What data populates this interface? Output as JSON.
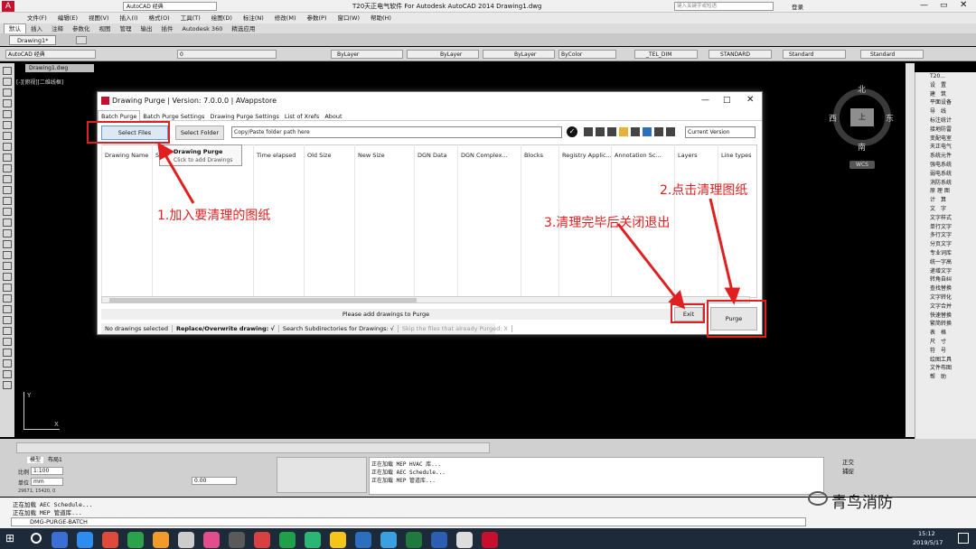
{
  "titlebar": {
    "title": "T20天正电气软件 For Autodesk AutoCAD 2014    Drawing1.dwg",
    "workspace": "AutoCAD 经典",
    "search_placeholder": "键入关键字或短语",
    "login": "登录"
  },
  "menus": [
    "文件(F)",
    "编辑(E)",
    "视图(V)",
    "插入(I)",
    "格式(O)",
    "工具(T)",
    "绘图(D)",
    "标注(N)",
    "修改(M)",
    "参数(P)",
    "窗口(W)",
    "帮助(H)"
  ],
  "ribbon_tabs": [
    "默认",
    "插入",
    "注释",
    "参数化",
    "视图",
    "管理",
    "输出",
    "插件",
    "Autodesk 360",
    "精选应用"
  ],
  "doc_tab": "Drawing1*",
  "props": {
    "workspace": "AutoCAD 经典",
    "layer": "0",
    "color": "ByLayer",
    "linetype": "ByLayer",
    "lineweight": "ByLayer",
    "plotstyle": "ByColor",
    "dimstyle": "_TEL_DIM",
    "textstyle": "STANDARD",
    "tablestyle": "Standard",
    "mlstyle": "Standard"
  },
  "viewport": {
    "label": "[-][俯视][二维线框]",
    "file_tab": "Drawing1.dwg"
  },
  "viewcube": {
    "north": "北",
    "south": "南",
    "east": "东",
    "west": "西",
    "top": "上",
    "wcs": "WCS"
  },
  "right_panel": [
    "T20...",
    "设　置",
    "建　筑",
    "平面设备",
    "导　线",
    "标注统计",
    "接地防雷",
    "变配电室",
    "天正电气",
    "系统元件",
    "强电系统",
    "弱电系统",
    "消防系统",
    "原 理 图",
    "计　算",
    "文　字",
    "文字样式",
    "单行文字",
    "多行文字",
    "分页文字",
    "专业词库",
    "统一字高",
    "递增文字",
    "转角自纠",
    "查找替换",
    "文字转化",
    "文字合并",
    "快速替换",
    "繁简转换",
    "表　格",
    "尺　寸",
    "符　号",
    "绘图工具",
    "文件布图",
    "帮　助"
  ],
  "dialog": {
    "title": "Drawing Purge | Version: 7.0.0.0 | AVappstore",
    "tabs": [
      "Batch Purge",
      "Batch Purge Settings",
      "Drawing Purge Settings",
      "List of Xrefs",
      "About"
    ],
    "select_files": "Select Files",
    "select_folder": "Select Folder",
    "path_placeholder": "Copy/Paste folder path here",
    "version_select": "Current Version",
    "tooltip_title": "Drawing Purge",
    "tooltip_text": "Click to add Drawings",
    "columns": [
      "Drawing Name",
      "St",
      "Time elapsed",
      "Old Size",
      "New Size",
      "DGN Data",
      "DGN Complex...",
      "Blocks",
      "Registry Applic...",
      "Annotation Sc...",
      "Layers",
      "Line types"
    ],
    "status": "Please add drawings to Purge",
    "exit": "Exit",
    "purge": "Purge",
    "footer": [
      "No drawings selected",
      "Replace/Overwrite drawing: √",
      "Search Subdirectories for Drawings: √",
      "Skip the files that already Purged: X"
    ]
  },
  "annotations": [
    "1.加入要清理的图纸",
    "2.点击清理图纸",
    "3.清理完毕后关闭退出"
  ],
  "bottom": {
    "scale_label": "比例",
    "scale_value": "1:100",
    "unit_label": "单位",
    "unit_value": "mm",
    "coord": "29671, 15420, 0",
    "cmd_tabs": [
      "模型",
      "布局1"
    ],
    "value": "0.00",
    "log1": "正在加载 MEP HVAC 库...",
    "log2": "正在加载 AEC Schedule...",
    "log3": "正在加载 MEP 管道库...",
    "osnap1": "正交",
    "osnap2": "捕捉"
  },
  "command": {
    "line1": "正在加载 AEC Schedule...",
    "line2": "正在加载 MEP 管道库...",
    "prompt": "DMG-PURGE-BATCH"
  },
  "watermark": "青鸟消防",
  "taskbar": {
    "time": "15:12",
    "date": "2019/5/17"
  }
}
